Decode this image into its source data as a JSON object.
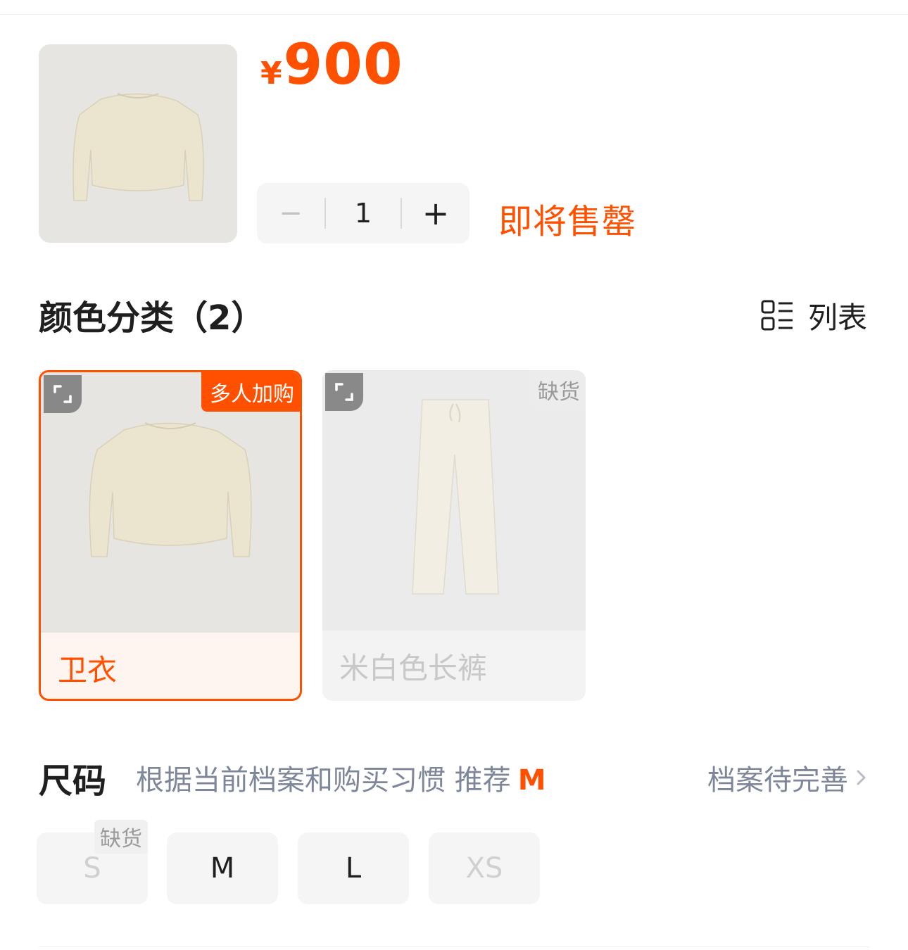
{
  "product": {
    "currency": "¥",
    "price": "900",
    "quantity": "1",
    "minus_label": "−",
    "plus_label": "+",
    "stock_status": "即将售罄"
  },
  "color_section": {
    "title": "颜色分类（2）",
    "view_toggle_label": "列表",
    "options": [
      {
        "label": "卫衣",
        "badge": "多人加购",
        "selected": true
      },
      {
        "label": "米白色长裤",
        "badge": "缺货",
        "disabled": true
      }
    ]
  },
  "size_section": {
    "title": "尺码",
    "recommendation": "根据当前档案和购买习惯 推荐",
    "recommended_size": "M",
    "profile_link": "档案待完善",
    "sizes": [
      {
        "label": "S",
        "out_badge": "缺货",
        "disabled": true
      },
      {
        "label": "M"
      },
      {
        "label": "L"
      },
      {
        "label": "XS",
        "disabled": true
      }
    ]
  },
  "colors": {
    "accent": "#ff5000",
    "muted_text": "#7e8699",
    "chip_bg": "#f5f5f5"
  }
}
